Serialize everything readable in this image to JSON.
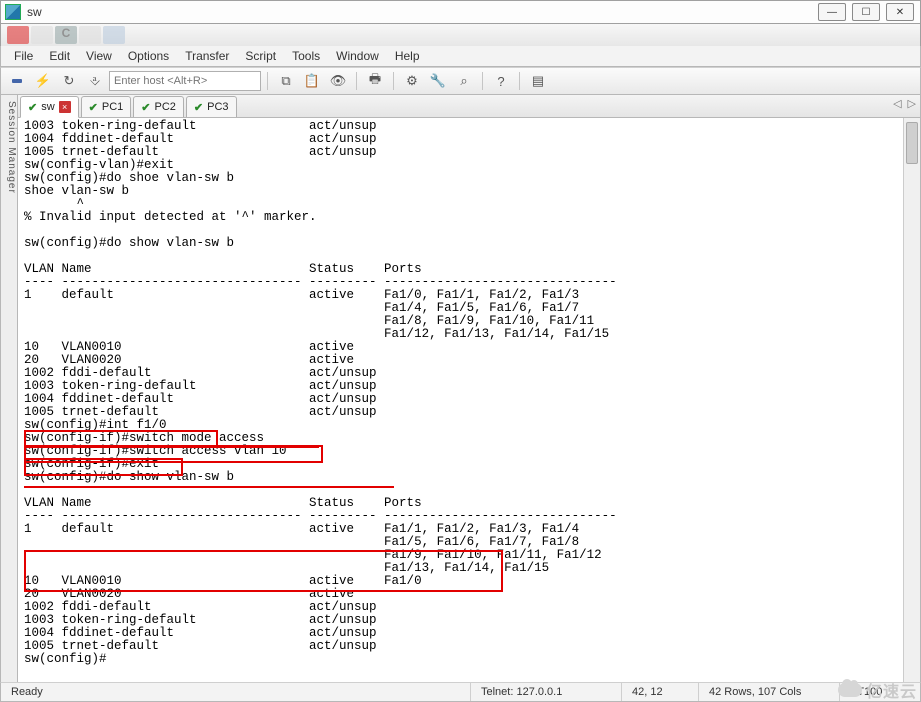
{
  "window": {
    "title": "sw"
  },
  "menus": [
    "File",
    "Edit",
    "View",
    "Options",
    "Transfer",
    "Script",
    "Tools",
    "Window",
    "Help"
  ],
  "host_input": {
    "placeholder": "Enter host <Alt+R>"
  },
  "toolbar_icons": {
    "connect": "connect-icon",
    "quick": "lightning-icon",
    "reconnect": "refresh-icon",
    "disconnect": "cmd-icon",
    "copy": "copy-icon",
    "paste": "paste-icon",
    "find": "find-icon",
    "print": "printer-icon",
    "settings": "gear-icon",
    "properties": "wrench-icon",
    "key": "key-icon",
    "help": "help-icon",
    "extra": "panel-icon"
  },
  "tabs": [
    {
      "label": "sw",
      "active": true,
      "icon": "check",
      "closeable": true
    },
    {
      "label": "PC1",
      "active": false,
      "icon": "check",
      "closeable": false
    },
    {
      "label": "PC2",
      "active": false,
      "icon": "check",
      "closeable": false
    },
    {
      "label": "PC3",
      "active": false,
      "icon": "check",
      "closeable": false
    }
  ],
  "side_label": "Session Manager",
  "terminal_lines": [
    "1003 token-ring-default               act/unsup",
    "1004 fddinet-default                  act/unsup",
    "1005 trnet-default                    act/unsup",
    "sw(config-vlan)#exit",
    "sw(config)#do shoe vlan-sw b",
    "shoe vlan-sw b",
    "       ^",
    "% Invalid input detected at '^' marker.",
    "",
    "sw(config)#do show vlan-sw b",
    "",
    "VLAN Name                             Status    Ports",
    "---- -------------------------------- --------- -------------------------------",
    "1    default                          active    Fa1/0, Fa1/1, Fa1/2, Fa1/3",
    "                                                Fa1/4, Fa1/5, Fa1/6, Fa1/7",
    "                                                Fa1/8, Fa1/9, Fa1/10, Fa1/11",
    "                                                Fa1/12, Fa1/13, Fa1/14, Fa1/15",
    "10   VLAN0010                         active",
    "20   VLAN0020                         active",
    "1002 fddi-default                     act/unsup",
    "1003 token-ring-default               act/unsup",
    "1004 fddinet-default                  act/unsup",
    "1005 trnet-default                    act/unsup",
    "sw(config)#int f1/0",
    "sw(config-if)#switch mode access",
    "sw(config-if)#switch access vlan 10",
    "sw(config-if)#exit",
    "sw(config)#do show vlan-sw b",
    "",
    "VLAN Name                             Status    Ports",
    "---- -------------------------------- --------- -------------------------------",
    "1    default                          active    Fa1/1, Fa1/2, Fa1/3, Fa1/4",
    "                                                Fa1/5, Fa1/6, Fa1/7, Fa1/8",
    "                                                Fa1/9, Fa1/10, Fa1/11, Fa1/12",
    "                                                Fa1/13, Fa1/14, Fa1/15",
    "10   VLAN0010                         active    Fa1/0",
    "20   VLAN0020                         active",
    "1002 fddi-default                     act/unsup",
    "1003 token-ring-default               act/unsup",
    "1004 fddinet-default                  act/unsup",
    "1005 trnet-default                    act/unsup",
    "sw(config)#"
  ],
  "status": {
    "ready": "Ready",
    "conn": "Telnet: 127.0.0.1",
    "cursor": "42,  12",
    "size": "42 Rows, 107 Cols",
    "emu": "VT100"
  },
  "watermark": "亿速云"
}
